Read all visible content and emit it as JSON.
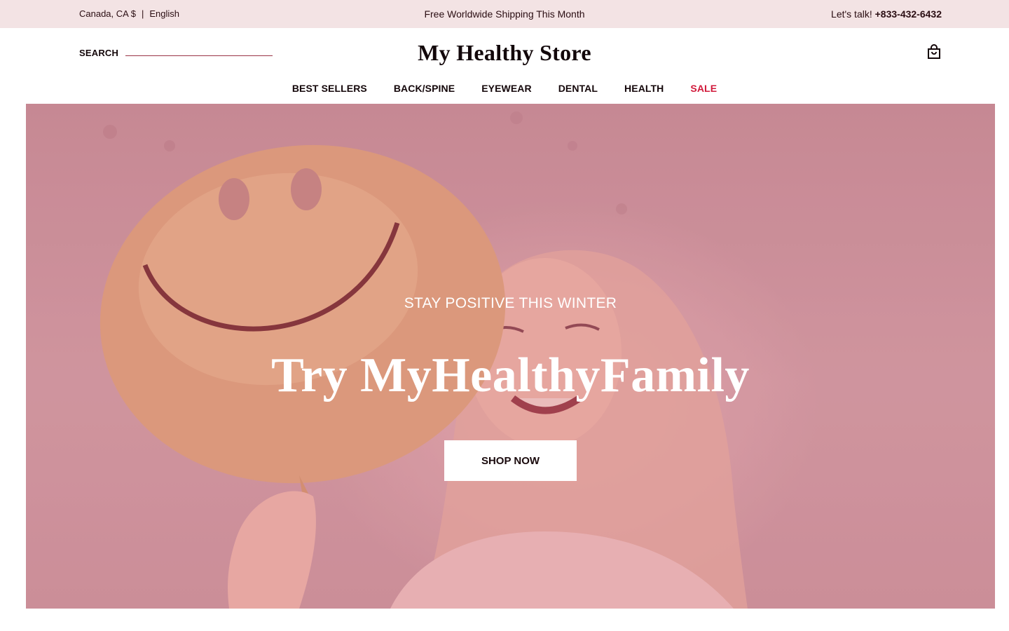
{
  "topbar": {
    "region": "Canada, CA $",
    "separator": "|",
    "language": "English",
    "promo": "Free Worldwide Shipping This Month",
    "contact_label": "Let's talk!",
    "phone": "+833-432-6432"
  },
  "header": {
    "search_label": "SEARCH",
    "logo": "My Healthy Store",
    "cart_icon": "shopping-bag-icon"
  },
  "nav": {
    "items": [
      {
        "label": "BEST SELLERS"
      },
      {
        "label": "BACK/SPINE"
      },
      {
        "label": "EYEWEAR"
      },
      {
        "label": "DENTAL"
      },
      {
        "label": "HEALTH"
      },
      {
        "label": "SALE",
        "color": "#d11a3b"
      }
    ]
  },
  "hero": {
    "eyebrow": "STAY POSITIVE THIS WINTER",
    "headline": "Try MyHealthyFamily",
    "cta": "SHOP NOW",
    "tint_color": "#c9939c"
  },
  "colors": {
    "topbar_bg": "#f3e3e4",
    "accent": "#d11a3b"
  }
}
